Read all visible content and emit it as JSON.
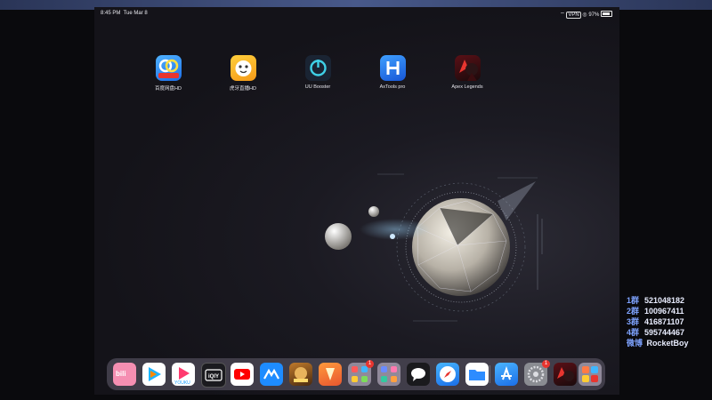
{
  "status_bar": {
    "time": "8:45 PM",
    "date": "Tue Mar 8",
    "battery": "97%",
    "icons": [
      "wifi-icon",
      "vpn-icon",
      "orientation-lock-icon",
      "battery-icon"
    ]
  },
  "home_apps": [
    {
      "label": "百度网盘HD",
      "icon": "baidu-netdisk-icon"
    },
    {
      "label": "虎牙直播HD",
      "icon": "huya-live-icon"
    },
    {
      "label": "UU Booster",
      "icon": "uu-booster-icon"
    },
    {
      "label": "AxTools pro",
      "icon": "axtools-icon"
    },
    {
      "label": "Apex Legends",
      "icon": "apex-legends-icon"
    }
  ],
  "dock_apps": [
    "bilibili-icon",
    "tencent-video-icon",
    "youku-icon",
    "iqiyi-icon",
    "youtube-icon",
    "baidu-input-icon",
    "game-icon",
    "honor-of-kings-icon",
    "folder-icon",
    "folder-icon-2",
    "messages-icon",
    "safari-icon",
    "files-icon",
    "app-store-icon",
    "settings-icon",
    "apex-legends-icon",
    "app-library-icon"
  ],
  "dock_badges": {
    "folder": "1",
    "settings": "1"
  },
  "groups": [
    {
      "key": "1群",
      "value": "521048182"
    },
    {
      "key": "2群",
      "value": "100967411"
    },
    {
      "key": "3群",
      "value": "416871107"
    },
    {
      "key": "4群",
      "value": "595744467"
    },
    {
      "key": "微博",
      "value": "RocketBoy"
    }
  ]
}
